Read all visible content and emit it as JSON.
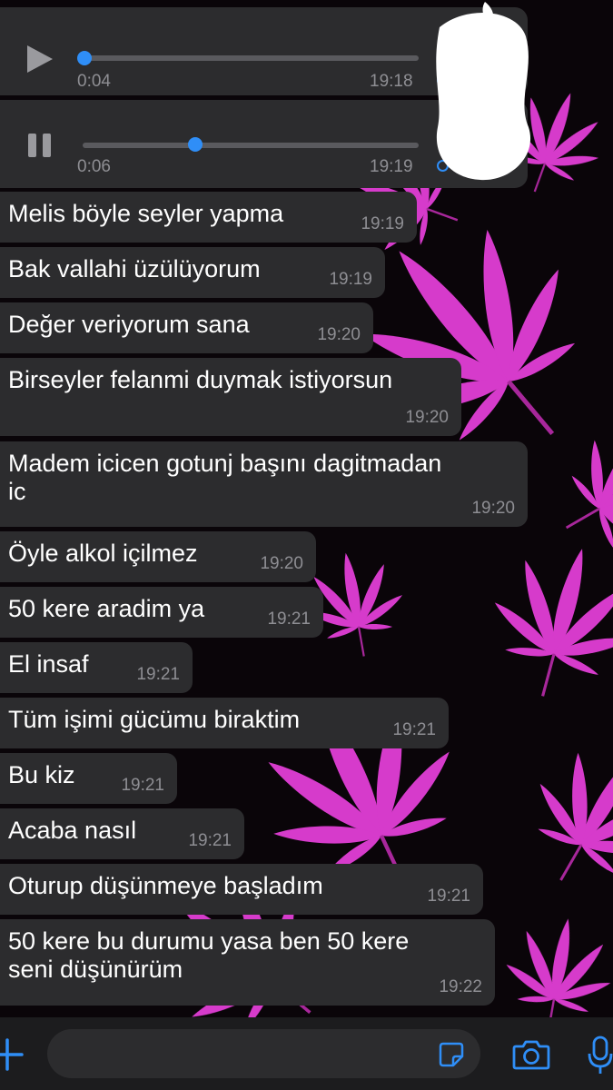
{
  "theme": {
    "bubble_color": "#2c2c2e",
    "text_color": "#ffffff",
    "timestamp_color": "#8e8e93",
    "accent_color": "#2f8ef7",
    "wallpaper_leaf_color": "#e23fd6",
    "wallpaper_background": "#0a0509"
  },
  "audio_messages": [
    {
      "state": "paused",
      "control_icon": "play-icon",
      "duration": "0:04",
      "time": "19:18",
      "progress": 0.0
    },
    {
      "state": "playing",
      "control_icon": "pause-icon",
      "duration": "0:06",
      "time": "19:19",
      "progress": 0.33
    }
  ],
  "messages": [
    {
      "text": "Melis böyle seyler yapma",
      "time": "19:19"
    },
    {
      "text": "Bak vallahi üzülüyorum",
      "time": "19:19"
    },
    {
      "text": "Değer veriyorum sana",
      "time": "19:20"
    },
    {
      "text": "Birseyler felanmi duymak istiyorsun",
      "time": "19:20"
    },
    {
      "text": "Madem icicen gotunj başını dagitmadan\nic",
      "time": "19:20"
    },
    {
      "text": "Öyle alkol içilmez",
      "time": "19:20"
    },
    {
      "text": "50 kere aradim ya",
      "time": "19:21"
    },
    {
      "text": "El insaf",
      "time": "19:21"
    },
    {
      "text": "Tüm işimi gücümu biraktim",
      "time": "19:21"
    },
    {
      "text": "Bu kiz",
      "time": "19:21"
    },
    {
      "text": "Acaba nasıl",
      "time": "19:21"
    },
    {
      "text": "Oturup düşünmeye başladım",
      "time": "19:21"
    },
    {
      "text": "50 kere bu durumu yasa ben 50 kere\nseni düşünürüm",
      "time": "19:22"
    }
  ],
  "input_bar": {
    "buttons": [
      "plus-icon",
      "sticker-icon",
      "camera-icon",
      "microphone-icon"
    ],
    "message_value": ""
  }
}
